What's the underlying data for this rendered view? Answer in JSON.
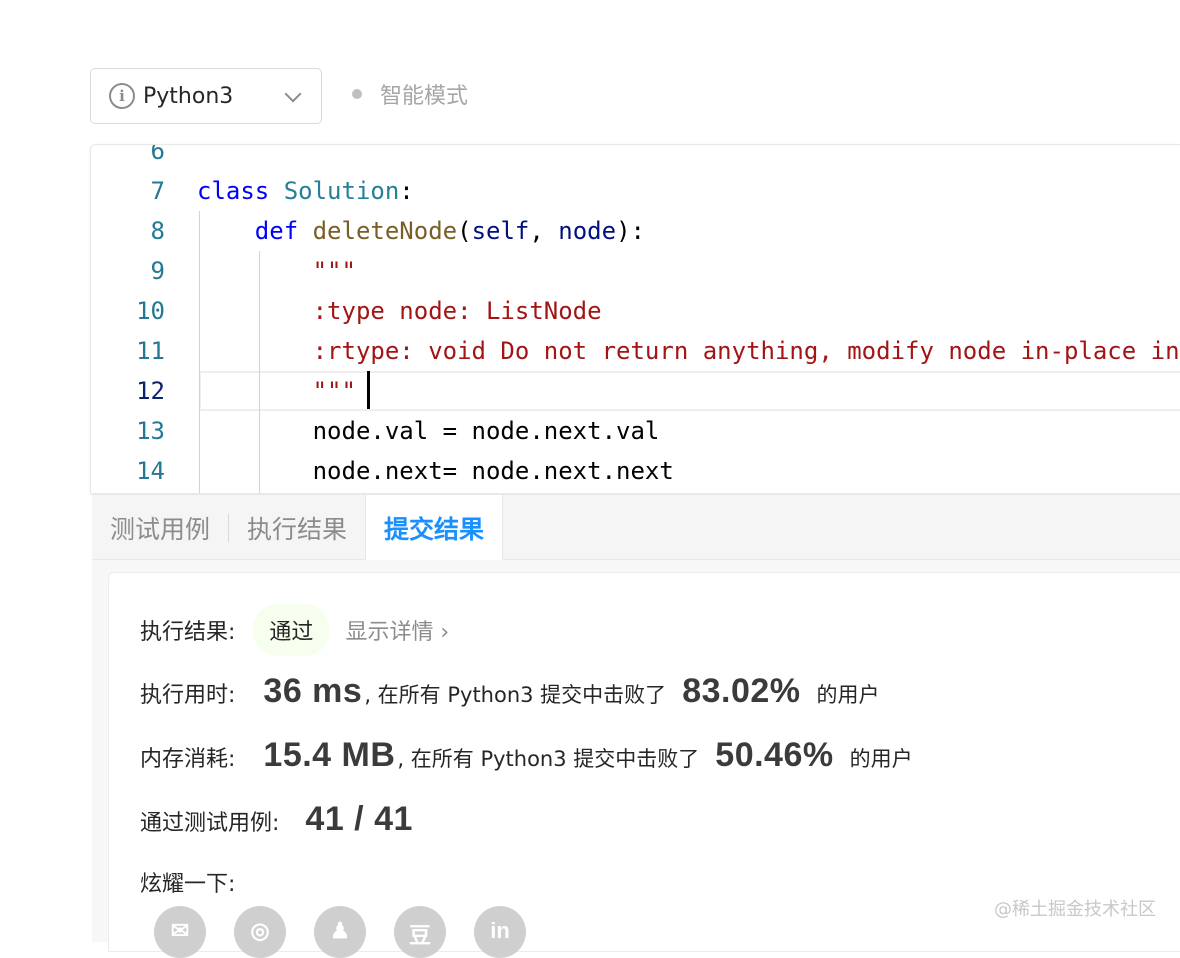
{
  "toolbar": {
    "language": "Python3",
    "mode_label": "智能模式"
  },
  "editor": {
    "active_line": 12,
    "lines": [
      {
        "num": "6",
        "tokens": []
      },
      {
        "num": "7",
        "tokens": [
          {
            "t": "class",
            "c": "kw"
          },
          {
            "t": " ",
            "c": "plain"
          },
          {
            "t": "Solution",
            "c": "cls"
          },
          {
            "t": ":",
            "c": "plain"
          }
        ]
      },
      {
        "num": "8",
        "tokens": [
          {
            "t": "    ",
            "c": "plain"
          },
          {
            "t": "def",
            "c": "kw"
          },
          {
            "t": " ",
            "c": "plain"
          },
          {
            "t": "deleteNode",
            "c": "fn"
          },
          {
            "t": "(",
            "c": "plain"
          },
          {
            "t": "self",
            "c": "param"
          },
          {
            "t": ", ",
            "c": "plain"
          },
          {
            "t": "node",
            "c": "param"
          },
          {
            "t": "):",
            "c": "plain"
          }
        ]
      },
      {
        "num": "9",
        "tokens": [
          {
            "t": "        ",
            "c": "plain"
          },
          {
            "t": "\"\"\"",
            "c": "str"
          }
        ]
      },
      {
        "num": "10",
        "tokens": [
          {
            "t": "        ",
            "c": "plain"
          },
          {
            "t": ":type node: ListNode",
            "c": "str"
          }
        ]
      },
      {
        "num": "11",
        "tokens": [
          {
            "t": "        ",
            "c": "plain"
          },
          {
            "t": ":rtype: void Do not return anything, modify node in-place instead.",
            "c": "str"
          }
        ]
      },
      {
        "num": "12",
        "tokens": [
          {
            "t": "        ",
            "c": "plain"
          },
          {
            "t": "\"\"\"",
            "c": "str"
          }
        ]
      },
      {
        "num": "13",
        "tokens": [
          {
            "t": "        node.val = node.next.val",
            "c": "plain"
          }
        ]
      },
      {
        "num": "14",
        "tokens": [
          {
            "t": "        node.next= node.next.next",
            "c": "plain"
          }
        ]
      }
    ]
  },
  "tabs": [
    {
      "label": "测试用例",
      "active": false
    },
    {
      "label": "执行结果",
      "active": false
    },
    {
      "label": "提交结果",
      "active": true
    }
  ],
  "result": {
    "status_label": "执行结果:",
    "status_value": "通过",
    "detail_link": "显示详情 ›",
    "runtime_label": "执行用时:",
    "runtime_value": "36 ms",
    "runtime_text": ", 在所有 Python3 提交中击败了",
    "runtime_percent": "83.02%",
    "runtime_suffix": "的用户",
    "memory_label": "内存消耗:",
    "memory_value": "15.4 MB",
    "memory_text": ", 在所有 Python3 提交中击败了",
    "memory_percent": "50.46%",
    "memory_suffix": "的用户",
    "tests_label": "通过测试用例:",
    "tests_value": "41 / 41",
    "share_label": "炫耀一下:"
  },
  "share_icons": [
    {
      "name": "wechat-icon",
      "glyph": "✉"
    },
    {
      "name": "weibo-icon",
      "glyph": "◎"
    },
    {
      "name": "qq-icon",
      "glyph": "♟"
    },
    {
      "name": "douban-icon",
      "glyph": "豆"
    },
    {
      "name": "linkedin-icon",
      "glyph": "in"
    }
  ],
  "watermark": "@稀土掘金技术社区"
}
